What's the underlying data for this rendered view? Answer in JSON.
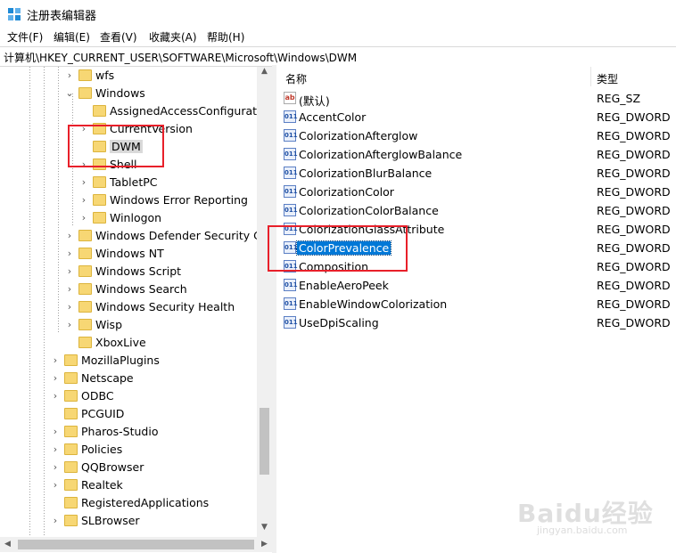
{
  "window": {
    "title": "注册表编辑器"
  },
  "menu": [
    {
      "label": "文件(F)"
    },
    {
      "label": "编辑(E)"
    },
    {
      "label": "查看(V)"
    },
    {
      "label": "收藏夹(A)"
    },
    {
      "label": "帮助(H)"
    }
  ],
  "address": {
    "path": "计算机\\HKEY_CURRENT_USER\\SOFTWARE\\Microsoft\\Windows\\DWM"
  },
  "tree": {
    "items": [
      {
        "label": "wfs",
        "expander": "collapsed"
      },
      {
        "label": "Windows",
        "expander": "expanded"
      },
      {
        "label": "AssignedAccessConfiguratio",
        "expander": "none"
      },
      {
        "label": "CurrentVersion",
        "expander": "collapsed"
      },
      {
        "label": "DWM",
        "expander": "none",
        "selected": true
      },
      {
        "label": "Shell",
        "expander": "collapsed"
      },
      {
        "label": "TabletPC",
        "expander": "collapsed"
      },
      {
        "label": "Windows Error Reporting",
        "expander": "collapsed"
      },
      {
        "label": "Winlogon",
        "expander": "collapsed"
      },
      {
        "label": "Windows Defender Security Cen",
        "expander": "collapsed"
      },
      {
        "label": "Windows NT",
        "expander": "collapsed"
      },
      {
        "label": "Windows Script",
        "expander": "collapsed"
      },
      {
        "label": "Windows Search",
        "expander": "collapsed"
      },
      {
        "label": "Windows Security Health",
        "expander": "collapsed"
      },
      {
        "label": "Wisp",
        "expander": "collapsed"
      },
      {
        "label": "XboxLive",
        "expander": "none"
      },
      {
        "label": "MozillaPlugins",
        "expander": "collapsed"
      },
      {
        "label": "Netscape",
        "expander": "collapsed"
      },
      {
        "label": "ODBC",
        "expander": "collapsed"
      },
      {
        "label": "PCGUID",
        "expander": "none"
      },
      {
        "label": "Pharos-Studio",
        "expander": "collapsed"
      },
      {
        "label": "Policies",
        "expander": "collapsed"
      },
      {
        "label": "QQBrowser",
        "expander": "collapsed"
      },
      {
        "label": "Realtek",
        "expander": "collapsed"
      },
      {
        "label": "RegisteredApplications",
        "expander": "none"
      },
      {
        "label": "SLBrowser",
        "expander": "collapsed"
      }
    ]
  },
  "list": {
    "headers": {
      "name": "名称",
      "type": "类型"
    },
    "rows": [
      {
        "name": "(默认)",
        "type": "REG_SZ",
        "icon": "string-value-icon"
      },
      {
        "name": "AccentColor",
        "type": "REG_DWORD",
        "icon": "binary-value-icon"
      },
      {
        "name": "ColorizationAfterglow",
        "type": "REG_DWORD",
        "icon": "binary-value-icon"
      },
      {
        "name": "ColorizationAfterglowBalance",
        "type": "REG_DWORD",
        "icon": "binary-value-icon"
      },
      {
        "name": "ColorizationBlurBalance",
        "type": "REG_DWORD",
        "icon": "binary-value-icon"
      },
      {
        "name": "ColorizationColor",
        "type": "REG_DWORD",
        "icon": "binary-value-icon"
      },
      {
        "name": "ColorizationColorBalance",
        "type": "REG_DWORD",
        "icon": "binary-value-icon"
      },
      {
        "name": "ColorizationGlassAttribute",
        "type": "REG_DWORD",
        "icon": "binary-value-icon"
      },
      {
        "name": "ColorPrevalence",
        "type": "REG_DWORD",
        "icon": "binary-value-icon",
        "selected": true
      },
      {
        "name": "Composition",
        "type": "REG_DWORD",
        "icon": "binary-value-icon"
      },
      {
        "name": "EnableAeroPeek",
        "type": "REG_DWORD",
        "icon": "binary-value-icon"
      },
      {
        "name": "EnableWindowColorization",
        "type": "REG_DWORD",
        "icon": "binary-value-icon"
      },
      {
        "name": "UseDpiScaling",
        "type": "REG_DWORD",
        "icon": "binary-value-icon"
      }
    ]
  },
  "watermark": {
    "logo": "Baidu经验",
    "url": "jingyan.baidu.com"
  },
  "colors": {
    "selection": "#0078d7",
    "annotation": "#e8202a",
    "folder": "#f7d774"
  }
}
